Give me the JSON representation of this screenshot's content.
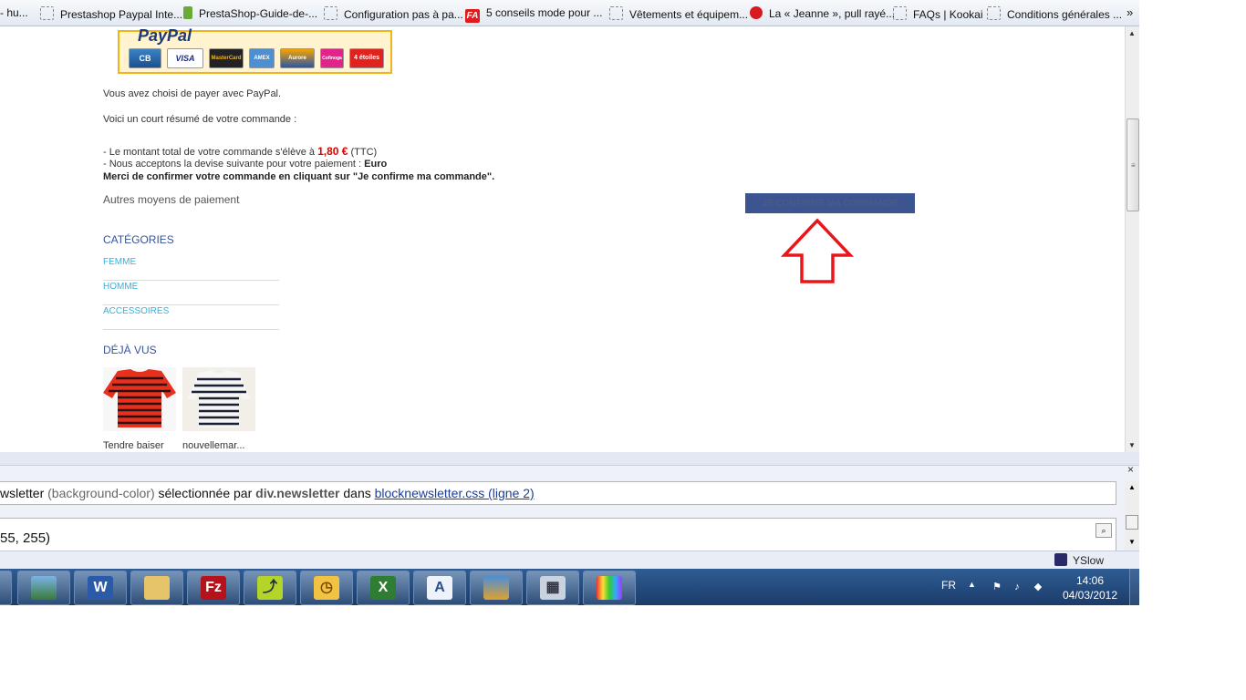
{
  "bookmarks": {
    "items": [
      {
        "label": "- hu...",
        "icon": "page-icon"
      },
      {
        "label": "Prestashop Paypal Inte...",
        "icon": "page-icon"
      },
      {
        "label": "PrestaShop-Guide-de-...",
        "icon": "prestashop-icon"
      },
      {
        "label": "Configuration pas à pa...",
        "icon": "page-icon"
      },
      {
        "label": "5 conseils mode pour ...",
        "icon": "fa-icon"
      },
      {
        "label": "Vêtements et équipem...",
        "icon": "page-icon"
      },
      {
        "label": "La « Jeanne », pull rayé...",
        "icon": "red-circle-icon"
      },
      {
        "label": "FAQs | Kookai",
        "icon": "page-icon"
      },
      {
        "label": "Conditions générales ...",
        "icon": "page-icon"
      }
    ],
    "more": "»"
  },
  "payment": {
    "paypal_logo": "PayPal",
    "cards": [
      "CB",
      "VISA",
      "MasterCard",
      "AMEX",
      "Aurore",
      "Cofinoga",
      "4 étoiles"
    ],
    "intro": "Vous avez choisi de payer avec PayPal.",
    "summary_heading": "Voici un court résumé de votre commande :",
    "total_prefix": "- Le montant total de votre commande s'élève à",
    "total_amount": "1,80 €",
    "total_suffix": "(TTC)",
    "currency_prefix": "- Nous acceptons la devise suivante pour votre paiement :",
    "currency": "Euro",
    "confirm_instruction": "Merci de confirmer votre commande en cliquant sur \"Je confirme ma commande\".",
    "other_methods": "Autres moyens de paiement",
    "confirm_button": "JE CONFIRME MA COMMANDE"
  },
  "categories": {
    "title": "CATÉGORIES",
    "items": [
      "FEMME",
      "HOMME",
      "ACCESSOIRES"
    ]
  },
  "viewed": {
    "title": "DÉJÀ VUS",
    "items": [
      "Tendre baiser",
      "nouvellemar..."
    ]
  },
  "devtools": {
    "line1_prop": "wsletter",
    "line1_paren": "(background-color)",
    "line1_text": "sélectionnée par",
    "line1_selector": "div.newsletter",
    "line1_in": "dans",
    "line1_link": "blocknewsletter.css (ligne 2)",
    "line2": "55, 255)",
    "close": "×"
  },
  "statusbar": {
    "yslow": "YSlow"
  },
  "taskbar": {
    "apps": [
      "Windows Explorer",
      "Photo Viewer",
      "Word",
      "Folder",
      "FileZilla",
      "Stairs",
      "Outlook",
      "Excel",
      "Reader",
      "Control Panel",
      "Calculator",
      "Media"
    ],
    "lang": "FR",
    "time": "14:06",
    "date": "04/03/2012"
  },
  "colors": {
    "accent_red": "#d00000",
    "confirm_bg": "#3c5591",
    "link_cyan": "#33b2d8",
    "heading_blue": "#36549a",
    "taskbar": "#1f4577"
  }
}
